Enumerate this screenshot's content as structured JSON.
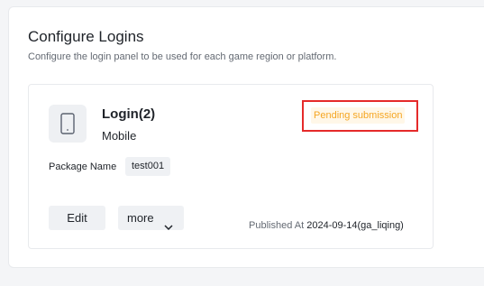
{
  "section": {
    "title": "Configure Logins",
    "subtitle": "Configure the login panel to be used for each game region or platform."
  },
  "card": {
    "icon": "tablet-icon",
    "name": "Login(2)",
    "type": "Mobile",
    "status": "Pending submission",
    "status_color": "#f5a623",
    "highlight_color": "#e52a2a",
    "package_label": "Package Name",
    "package_value": "test001",
    "edit_label": "Edit",
    "more_label": "more",
    "published_label": "Published At",
    "published_value": "2024-09-14(ga_liqing)"
  }
}
